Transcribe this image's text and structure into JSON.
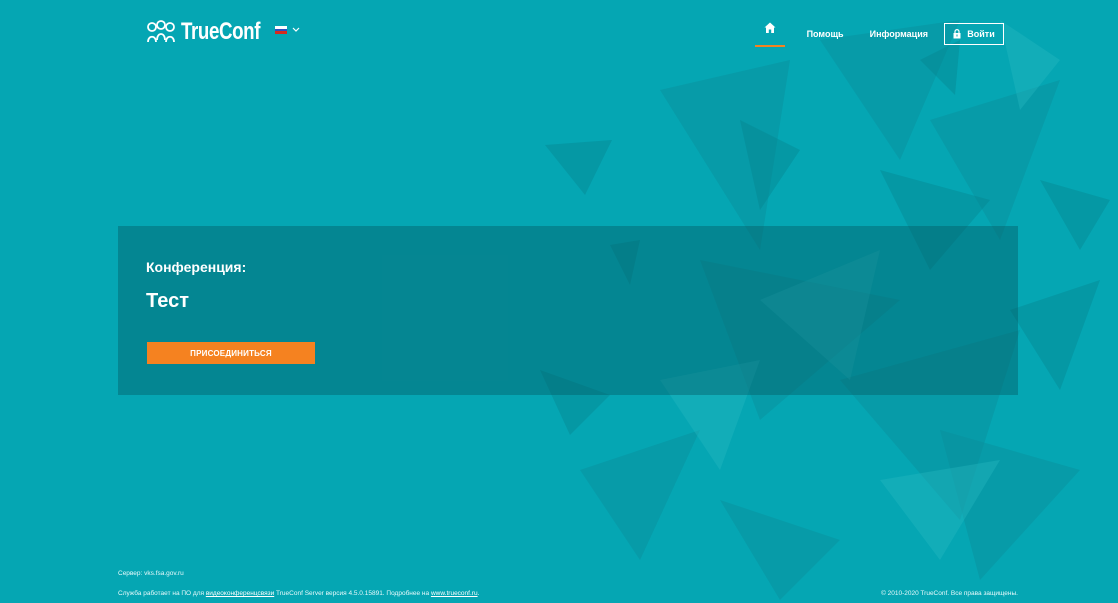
{
  "colors": {
    "background": "#05a6b3",
    "accent": "#f58220",
    "panel": "rgba(5,90,100,0.42)"
  },
  "header": {
    "logo_text": "TrueConf",
    "language": {
      "flag": "ru-flag-icon",
      "chevron": "chevron-down-icon"
    },
    "nav": {
      "home_icon": "home-icon",
      "help_label": "Помощь",
      "info_label": "Информация",
      "login_label": "Войти",
      "login_icon": "lock-icon"
    }
  },
  "main": {
    "conference_label": "Конференция:",
    "conference_name": "Тест",
    "join_button_label": "ПРИСОЕДИНИТЬСЯ"
  },
  "footer": {
    "server_text": "Сервер: vks.fsa.gov.ru",
    "service_prefix": "Служба работает на ПО для ",
    "service_link": "видеоконференцсвязи",
    "service_middle": " TrueConf Server версия 4.5.0.15891. Подробнее на ",
    "site_link": "www.trueconf.ru",
    "service_suffix": ".",
    "copyright": "© 2010-2020 TrueConf. Все права защищены."
  }
}
